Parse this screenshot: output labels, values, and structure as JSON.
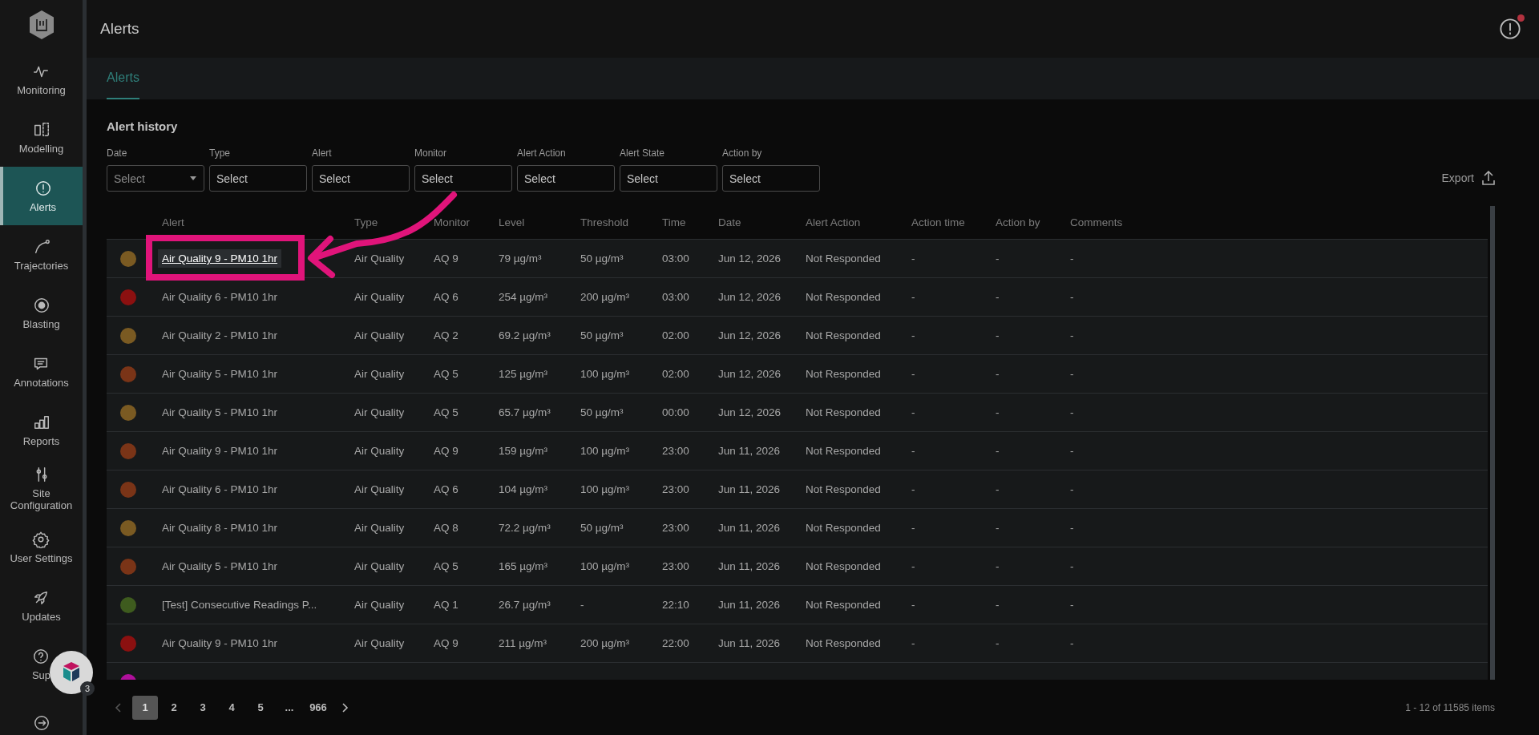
{
  "header": {
    "title": "Alerts",
    "notification_dot": true
  },
  "sidebar": {
    "items": [
      {
        "label": "Monitoring",
        "selected": false
      },
      {
        "label": "Modelling",
        "selected": false
      },
      {
        "label": "Alerts",
        "selected": true
      },
      {
        "label": "Trajectories",
        "selected": false
      },
      {
        "label": "Blasting",
        "selected": false
      },
      {
        "label": "Annotations",
        "selected": false
      },
      {
        "label": "Reports",
        "selected": false
      },
      {
        "label": "Site Configuration",
        "selected": false
      },
      {
        "label": "User Settings",
        "selected": false
      },
      {
        "label": "Updates",
        "selected": false
      },
      {
        "label": "Sup",
        "selected": false
      },
      {
        "selected": false
      }
    ]
  },
  "tabs": [
    {
      "label": "Alerts",
      "selected": true
    }
  ],
  "section_title": "Alert history",
  "filters": [
    {
      "label": "Date",
      "placeholder": "Select",
      "kind": "dropdown"
    },
    {
      "label": "Type",
      "placeholder": "Select",
      "kind": "text"
    },
    {
      "label": "Alert",
      "placeholder": "Select",
      "kind": "text"
    },
    {
      "label": "Monitor",
      "placeholder": "Select",
      "kind": "text"
    },
    {
      "label": "Alert Action",
      "placeholder": "Select",
      "kind": "text"
    },
    {
      "label": "Alert State",
      "placeholder": "Select",
      "kind": "text"
    },
    {
      "label": "Action by",
      "placeholder": "Select",
      "kind": "text"
    }
  ],
  "export": {
    "label": "Export"
  },
  "table": {
    "columns": [
      "Alert",
      "Type",
      "Monitor",
      "Level",
      "Threshold",
      "Time",
      "Date",
      "Alert Action",
      "Action time",
      "Action by",
      "Comments"
    ],
    "rows": [
      {
        "color": "#7a5a22",
        "highlighted": true,
        "cells": [
          "Air Quality 9 - PM10 1hr",
          "Air Quality",
          "AQ 9",
          "79 µg/m³",
          "50 µg/m³",
          "03:00",
          "Jun 12, 2026",
          "Not Responded",
          "-",
          "-",
          "-"
        ]
      },
      {
        "color": "#8b1010",
        "highlighted": false,
        "cells": [
          "Air Quality 6 - PM10 1hr",
          "Air Quality",
          "AQ 6",
          "254 µg/m³",
          "200 µg/m³",
          "03:00",
          "Jun 12, 2026",
          "Not Responded",
          "-",
          "-",
          "-"
        ]
      },
      {
        "color": "#7a5a22",
        "highlighted": false,
        "cells": [
          "Air Quality 2 - PM10 1hr",
          "Air Quality",
          "AQ 2",
          "69.2 µg/m³",
          "50 µg/m³",
          "02:00",
          "Jun 12, 2026",
          "Not Responded",
          "-",
          "-",
          "-"
        ]
      },
      {
        "color": "#7a3417",
        "highlighted": false,
        "cells": [
          "Air Quality 5 - PM10 1hr",
          "Air Quality",
          "AQ 5",
          "125 µg/m³",
          "100 µg/m³",
          "02:00",
          "Jun 12, 2026",
          "Not Responded",
          "-",
          "-",
          "-"
        ]
      },
      {
        "color": "#7a5a22",
        "highlighted": false,
        "cells": [
          "Air Quality 5 - PM10 1hr",
          "Air Quality",
          "AQ 5",
          "65.7 µg/m³",
          "50 µg/m³",
          "00:00",
          "Jun 12, 2026",
          "Not Responded",
          "-",
          "-",
          "-"
        ]
      },
      {
        "color": "#7a3417",
        "highlighted": false,
        "cells": [
          "Air Quality 9 - PM10 1hr",
          "Air Quality",
          "AQ 9",
          "159 µg/m³",
          "100 µg/m³",
          "23:00",
          "Jun 11, 2026",
          "Not Responded",
          "-",
          "-",
          "-"
        ]
      },
      {
        "color": "#7a3417",
        "highlighted": false,
        "cells": [
          "Air Quality 6 - PM10 1hr",
          "Air Quality",
          "AQ 6",
          "104 µg/m³",
          "100 µg/m³",
          "23:00",
          "Jun 11, 2026",
          "Not Responded",
          "-",
          "-",
          "-"
        ]
      },
      {
        "color": "#7a5a22",
        "highlighted": false,
        "cells": [
          "Air Quality 8 - PM10 1hr",
          "Air Quality",
          "AQ 8",
          "72.2 µg/m³",
          "50 µg/m³",
          "23:00",
          "Jun 11, 2026",
          "Not Responded",
          "-",
          "-",
          "-"
        ]
      },
      {
        "color": "#7a3417",
        "highlighted": false,
        "cells": [
          "Air Quality 5 - PM10 1hr",
          "Air Quality",
          "AQ 5",
          "165 µg/m³",
          "100 µg/m³",
          "23:00",
          "Jun 11, 2026",
          "Not Responded",
          "-",
          "-",
          "-"
        ]
      },
      {
        "color": "#3e5b1e",
        "highlighted": false,
        "cells": [
          "[Test] Consecutive Readings P...",
          "Air Quality",
          "AQ 1",
          "26.7 µg/m³",
          "-",
          "22:10",
          "Jun 11, 2026",
          "Not Responded",
          "-",
          "-",
          "-"
        ]
      },
      {
        "color": "#8b1010",
        "highlighted": false,
        "cells": [
          "Air Quality 9 - PM10 1hr",
          "Air Quality",
          "AQ 9",
          "211 µg/m³",
          "200 µg/m³",
          "22:00",
          "Jun 11, 2026",
          "Not Responded",
          "-",
          "-",
          "-"
        ]
      },
      {
        "color": "#b0109c",
        "cells": []
      }
    ]
  },
  "pagination": {
    "pages": [
      {
        "label": "1",
        "selected": true
      },
      {
        "label": "2",
        "selected": false
      },
      {
        "label": "3",
        "selected": false
      },
      {
        "label": "4",
        "selected": false
      },
      {
        "label": "5",
        "selected": false
      },
      {
        "label": "...",
        "selected": false
      },
      {
        "label": "966",
        "selected": false
      }
    ],
    "summary": "1 - 12 of 11585 items"
  },
  "help_widget": {
    "badge": "3"
  }
}
